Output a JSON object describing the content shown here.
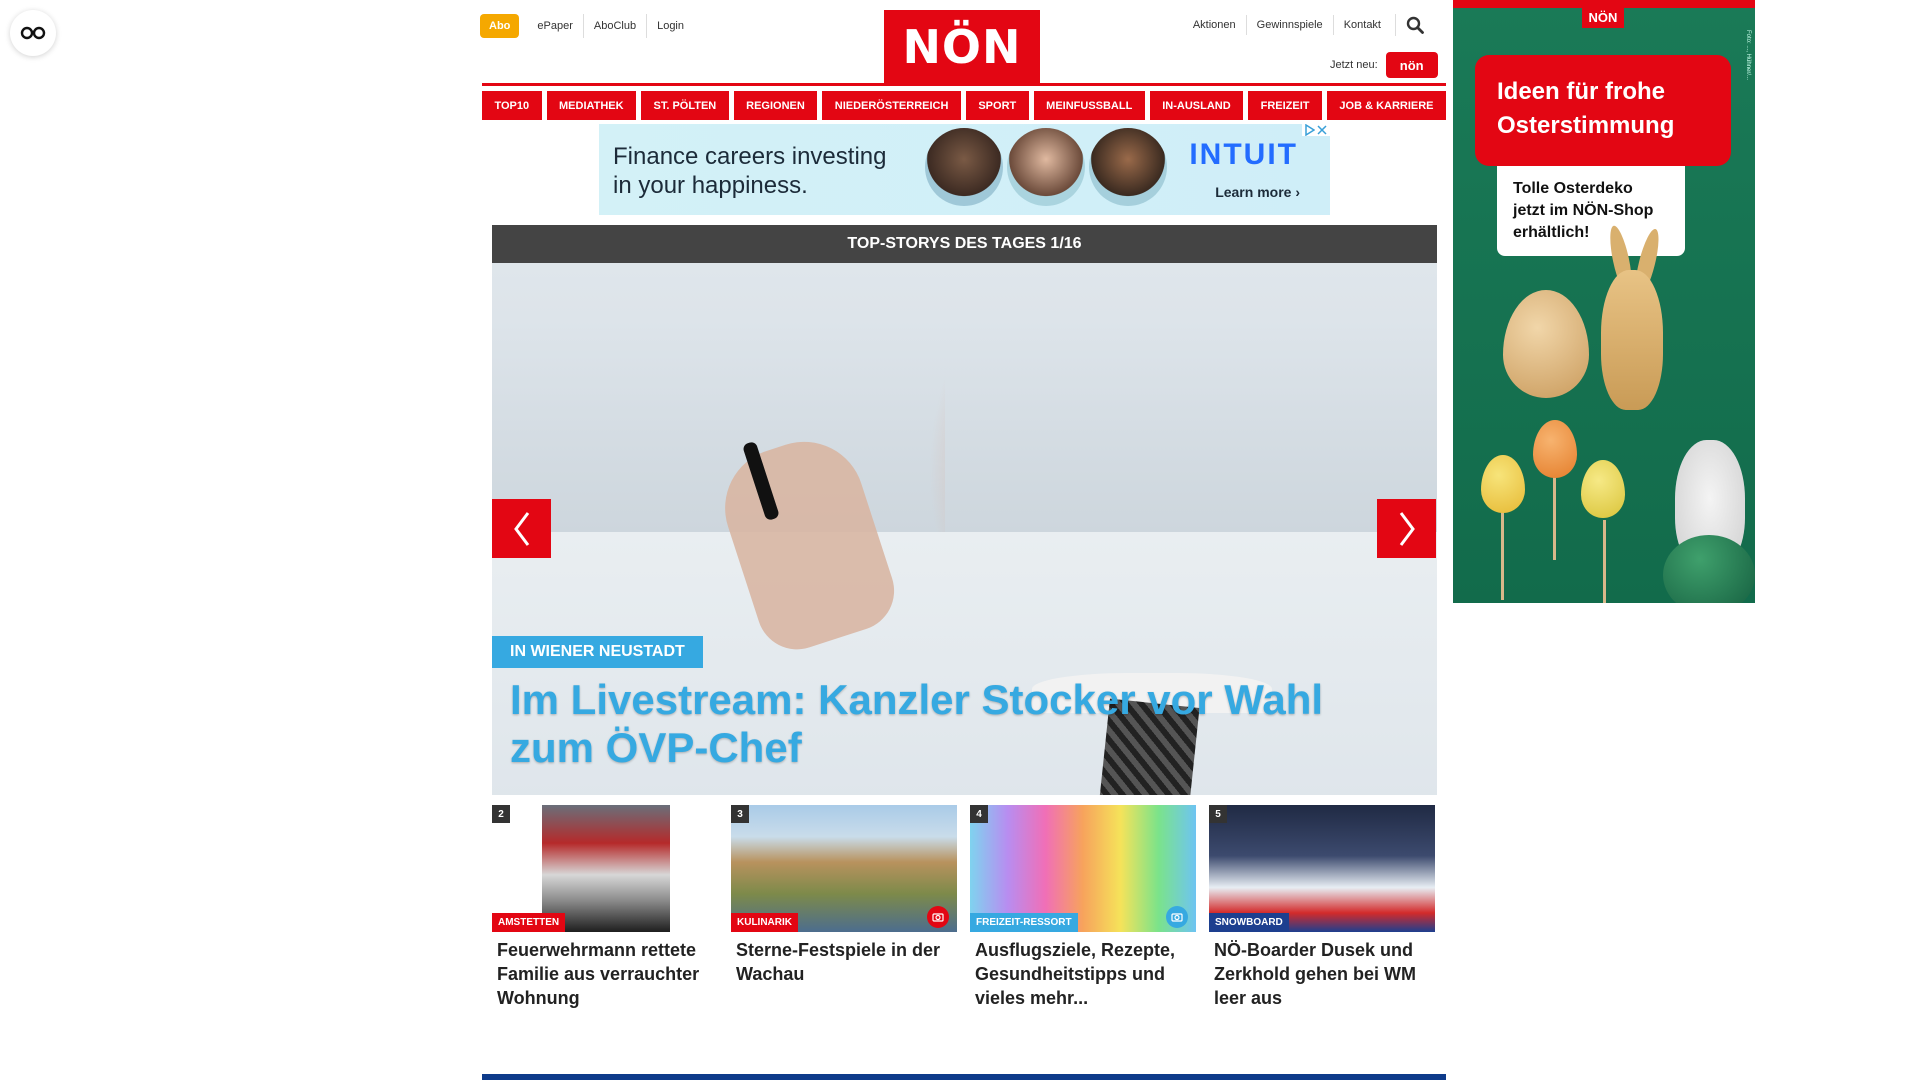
{
  "header": {
    "abo_label": "Abo",
    "top_links": [
      "ePaper",
      "AboClub",
      "Login"
    ],
    "logo_text": "NÖN",
    "right_links": [
      "Aktionen",
      "Gewinnspiele",
      "Kontakt"
    ],
    "jetzt_neu_label": "Jetzt neu:",
    "jetzt_neu_badge": "nön"
  },
  "nav": {
    "items": [
      "TOP10",
      "MEDIATHEK",
      "ST. PÖLTEN",
      "REGIONEN",
      "NIEDERÖSTERREICH",
      "SPORT",
      "MEINFUSSBALL",
      "IN-AUSLAND",
      "FREIZEIT",
      "JOB & KARRIERE"
    ]
  },
  "ad_banner": {
    "line1": "Finance careers investing",
    "line2": "in your happiness.",
    "brand": "INTUIT",
    "cta": "Learn more ›"
  },
  "top_stories": {
    "header": "TOP-STORYS DES TAGES 1/16",
    "hero": {
      "category": "IN WIENER NEUSTADT",
      "title": "Im Livestream: Kanzler Stocker vor Wahl zum ÖVP-Chef"
    },
    "cards": [
      {
        "number": "2",
        "category": "AMSTETTEN",
        "title": "Feuerwehrmann rettete Familie aus verrauchter Wohnung",
        "category_color": "#e30613"
      },
      {
        "number": "3",
        "category": "KULINARIK",
        "title": "Sterne-Festspiele in der Wachau",
        "category_color": "#e30613"
      },
      {
        "number": "4",
        "category": "FREIZEIT-RESSORT",
        "title": "Ausflugsziele, Rezepte, Gesundheitstipps und vieles mehr...",
        "category_color": "#36a9e1"
      },
      {
        "number": "5",
        "category": "SNOWBOARD",
        "title": "NÖ-Boarder Dusek und Zerkhold gehen bei WM leer aus",
        "category_color": "#1d3f8f"
      }
    ]
  },
  "side_ad": {
    "logo": "NÖN",
    "headline_line1": "Ideen für frohe",
    "headline_line2": "Osterstimmung",
    "note_line1": "Tolle Osterdeko",
    "note_line2": "jetzt im NÖN-Shop",
    "note_line3": "erhältlich!",
    "credit": "Foto: ..., Hühner/..."
  },
  "colors": {
    "brand_red": "#e30613",
    "accent_blue": "#36a9e1",
    "abo_orange": "#f5a800"
  },
  "icons": {
    "float_button": "glasses-icon",
    "search": "search-icon",
    "prev": "chevron-left-icon",
    "next": "chevron-right-icon",
    "camera": "camera-icon"
  }
}
